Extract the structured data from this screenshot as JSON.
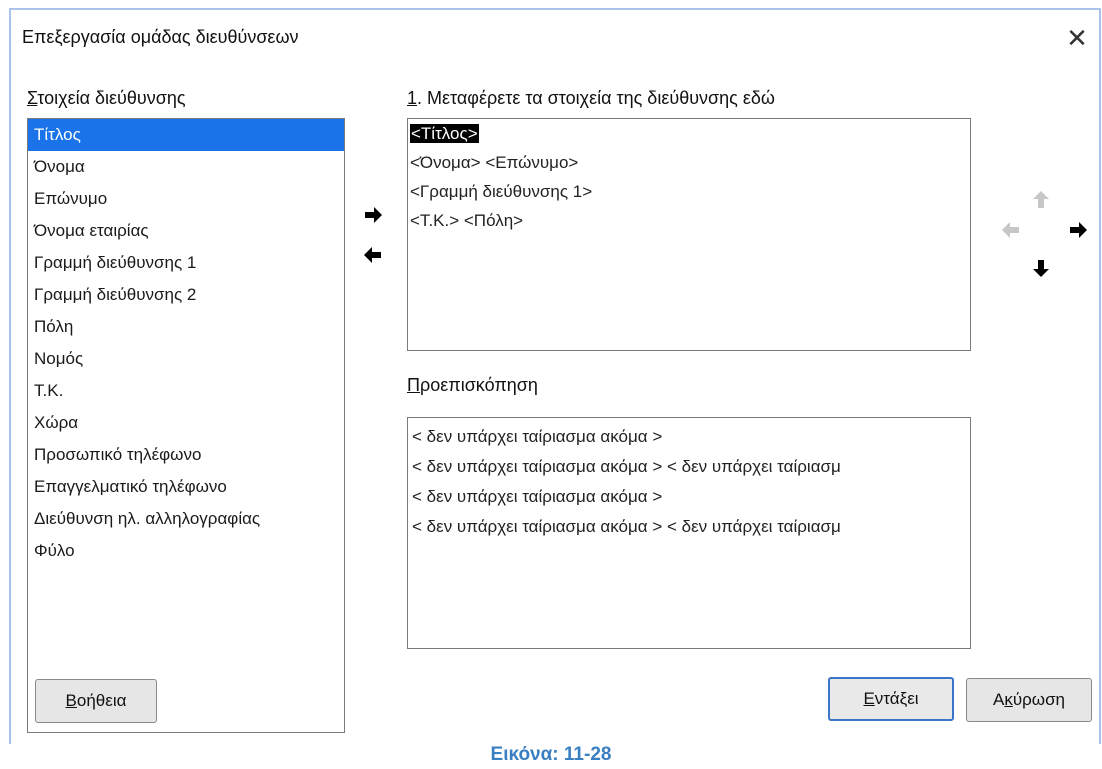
{
  "dialog": {
    "title": "Επεξεργασία ομάδας διευθύνσεων",
    "close_glyph": "✕"
  },
  "fields": {
    "label_prefix": "Σ",
    "label_rest": "τοιχεία διεύθυνσης",
    "items": [
      "Τίτλος",
      "Όνομα",
      "Επώνυμο",
      "Όνομα εταιρίας",
      "Γραμμή διεύθυνσης 1",
      "Γραμμή διεύθυνσης 2",
      "Πόλη",
      "Νομός",
      "Τ.Κ.",
      "Χώρα",
      "Προσωπικό τηλέφωνο",
      "Επαγγελματικό τηλέφωνο",
      "Διεύθυνση ηλ. αλληλογραφίας",
      "Φύλο"
    ],
    "selected_index": 0
  },
  "drop": {
    "label_prefix": "1",
    "label_rest": ". Μεταφέρετε τα στοιχεία της διεύθυνσης εδώ",
    "selected_token": "<Τίτλος>",
    "lines": [
      "<Όνομα> <Επώνυμο>",
      "<Γραμμή διεύθυνσης 1>",
      "<Τ.Κ.> <Πόλη>"
    ]
  },
  "preview": {
    "label_prefix": "Π",
    "label_rest": "ροεπισκόπηση",
    "lines": [
      "< δεν υπάρχει ταίριασμα ακόμα >",
      "< δεν υπάρχει ταίριασμα ακόμα > < δεν υπάρχει ταίριασμ",
      "< δεν υπάρχει ταίριασμα ακόμα >",
      "< δεν υπάρχει ταίριασμα ακόμα > < δεν υπάρχει ταίριασμ"
    ]
  },
  "buttons": {
    "help_prefix": "Β",
    "help_rest": "οήθεια",
    "ok_prefix": "Ε",
    "ok_rest": "ντάξει",
    "cancel_a": "Α",
    "cancel_u": "κ",
    "cancel_rest": "ύρωση"
  },
  "caption": "Εικόνα: 11-28"
}
